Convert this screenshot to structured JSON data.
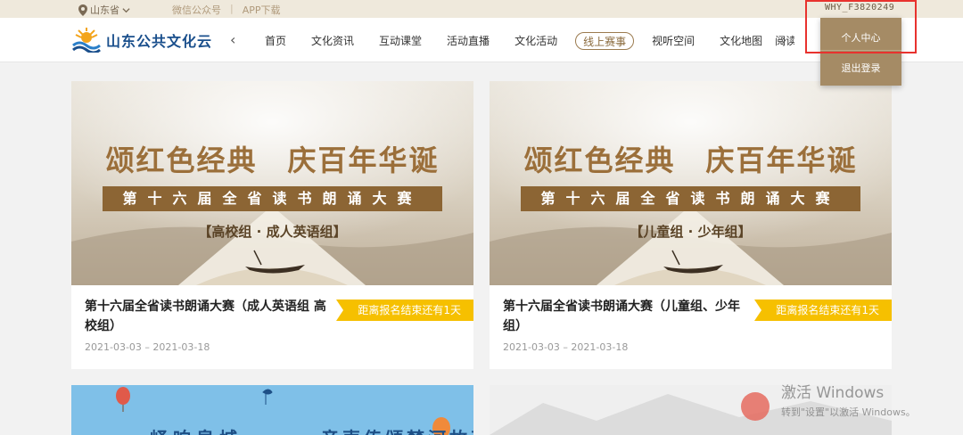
{
  "topbar": {
    "location": "山东省",
    "wechat": "微信公众号",
    "separator": "|",
    "app_download": "APP下载",
    "username": "WHY_F3820249"
  },
  "logo": {
    "text": "山东公共文化云"
  },
  "nav": {
    "prev_arrow": "‹",
    "next_arrow": "›",
    "items": [
      "首页",
      "文化资讯",
      "互动课堂",
      "活动直播",
      "文化活动",
      "线上赛事",
      "视听空间",
      "文化地图",
      "阅读"
    ],
    "active_index": 5
  },
  "dropdown": {
    "profile": "个人中心",
    "logout": "退出登录"
  },
  "cards": [
    {
      "banner_title": "颂红色经典　庆百年华诞",
      "banner_strip": "第十六届全省读书朗诵大赛",
      "banner_sub": "【高校组 · 成人英语组】",
      "title": "第十六届全省读书朗诵大赛（成人英语组 高校组）",
      "badge": "距离报名结束还有1天",
      "date": "2021-03-03 – 2021-03-18"
    },
    {
      "banner_title": "颂红色经典　庆百年华诞",
      "banner_strip": "第十六届全省读书朗诵大赛",
      "banner_sub": "【儿童组 · 少年组】",
      "title": "第十六届全省读书朗诵大赛（儿童组、少年组）",
      "badge": "距离报名结束还有1天",
      "date": "2021-03-03 – 2021-03-18"
    }
  ],
  "lower_cards": {
    "c3_text_a": "峄响泉城",
    "c3_text_b": "音声传颂梦河故事"
  },
  "watermark": {
    "line1": "激活 Windows",
    "line2": "转到\"设置\"以激活 Windows。"
  },
  "colors": {
    "accent": "#a58b65",
    "badge": "#f6c000",
    "highlight": "#e8322e",
    "brand": "#1a4f8c"
  }
}
